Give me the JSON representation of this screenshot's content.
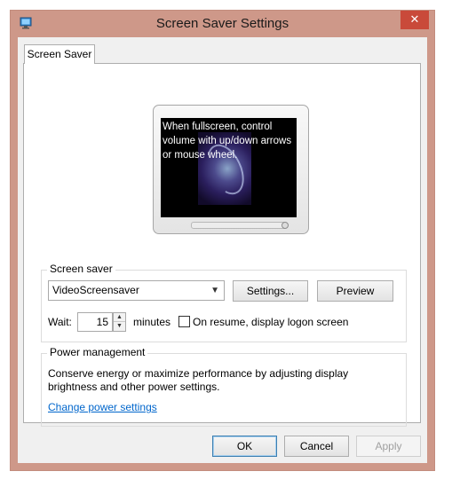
{
  "window": {
    "title": "Screen Saver Settings",
    "close_glyph": "✕"
  },
  "tabs": [
    {
      "label": "Screen Saver",
      "selected": true
    }
  ],
  "preview_text": "When fullscreen, control volume with up/down arrows or mouse wheel.",
  "screen_saver": {
    "group_label": "Screen saver",
    "selected": "VideoScreensaver",
    "settings_label": "Settings...",
    "preview_label": "Preview",
    "wait_label": "Wait:",
    "wait_value": "15",
    "minutes_label": "minutes",
    "resume_label": "On resume, display logon screen",
    "resume_checked": false
  },
  "power": {
    "group_label": "Power management",
    "description": "Conserve energy or maximize performance by adjusting display brightness and other power settings.",
    "link": "Change power settings"
  },
  "buttons": {
    "ok": "OK",
    "cancel": "Cancel",
    "apply": "Apply"
  },
  "colors": {
    "frame": "#ce9889",
    "close": "#c94a3a",
    "link": "#0066cc"
  }
}
